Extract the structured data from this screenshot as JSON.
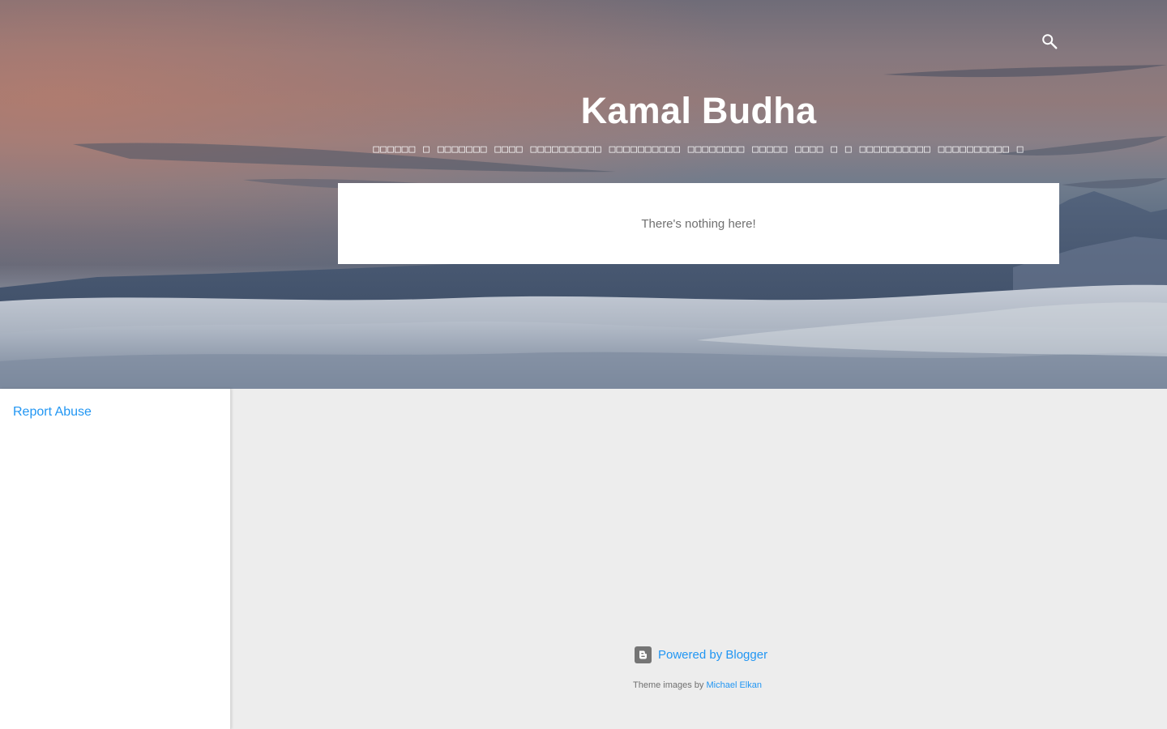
{
  "header": {
    "title": "Kamal Budha",
    "description": "□□□□□□ □ □□□□□□□ □□□□ □□□□□□□□□□ □□□□□□□□□□ □□□□□□□□ □□□□□ □□□□ □ □ □□□□□□□□□□ □□□□□□□□□□ □",
    "search_icon": "search-icon"
  },
  "main": {
    "empty_message": "There's nothing here!"
  },
  "sidebar": {
    "report_abuse": "Report Abuse"
  },
  "footer": {
    "powered_by": "Powered by Blogger",
    "blogger_icon": "blogger-icon",
    "theme_images_prefix": "Theme images by",
    "theme_images_author": "Michael Elkan"
  },
  "colors": {
    "link": "#2196f3",
    "background": "#ededed",
    "card": "#ffffff",
    "muted_text": "#707070"
  }
}
